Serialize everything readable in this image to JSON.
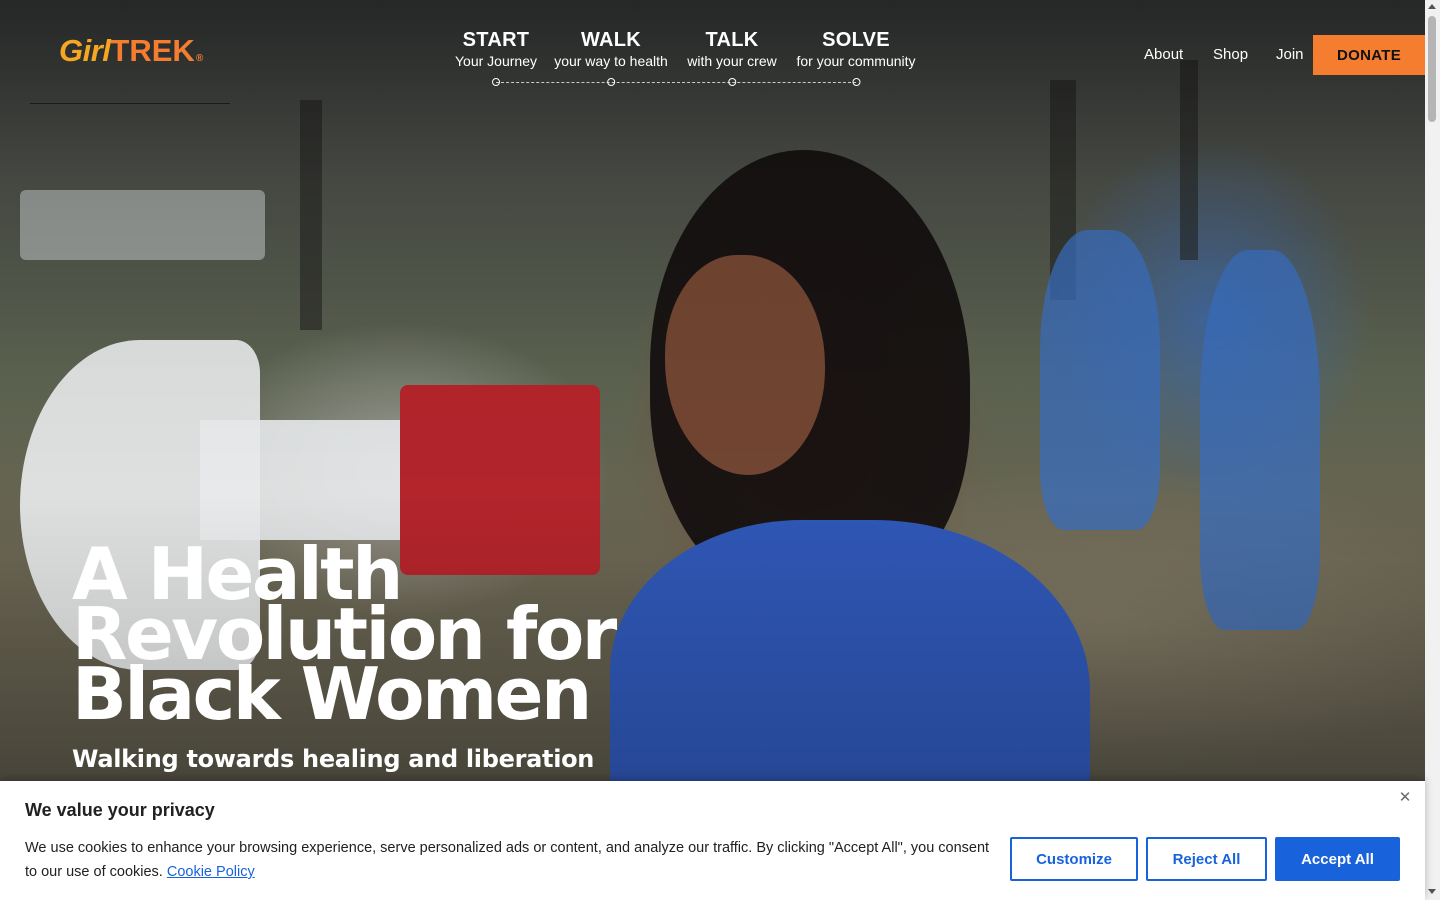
{
  "brand": {
    "logo_girl": "Girl",
    "logo_trek": "TREK",
    "logo_reg": "®"
  },
  "steps": [
    {
      "title": "START",
      "subtitle": "Your Journey"
    },
    {
      "title": "WALK",
      "subtitle": "your way to health"
    },
    {
      "title": "TALK",
      "subtitle": "with your crew"
    },
    {
      "title": "SOLVE",
      "subtitle": "for your community"
    }
  ],
  "nav": {
    "about": "About",
    "shop": "Shop",
    "join": "Join",
    "donate": "DONATE"
  },
  "hero": {
    "headline_line1": "A Health",
    "headline_line2": "Revolution for",
    "headline_line3": "Black Women",
    "subhead": "Walking towards healing and liberation"
  },
  "cookie": {
    "title": "We value your privacy",
    "text": "We use cookies to enhance your browsing experience, serve personalized ads or content, and analyze our traffic. By clicking \"Accept All\", you consent to our use of cookies.",
    "policy_link": "Cookie Policy",
    "close": "✕",
    "customize": "Customize",
    "reject": "Reject All",
    "accept": "Accept All"
  },
  "colors": {
    "brand_orange": "#f47d30",
    "logo_yellow": "#f5a623",
    "cookie_blue": "#1863dc",
    "shirt_blue": "#2f57b6"
  },
  "icons": [
    "close-icon",
    "scroll-up-arrow-icon",
    "scroll-down-arrow-icon"
  ]
}
